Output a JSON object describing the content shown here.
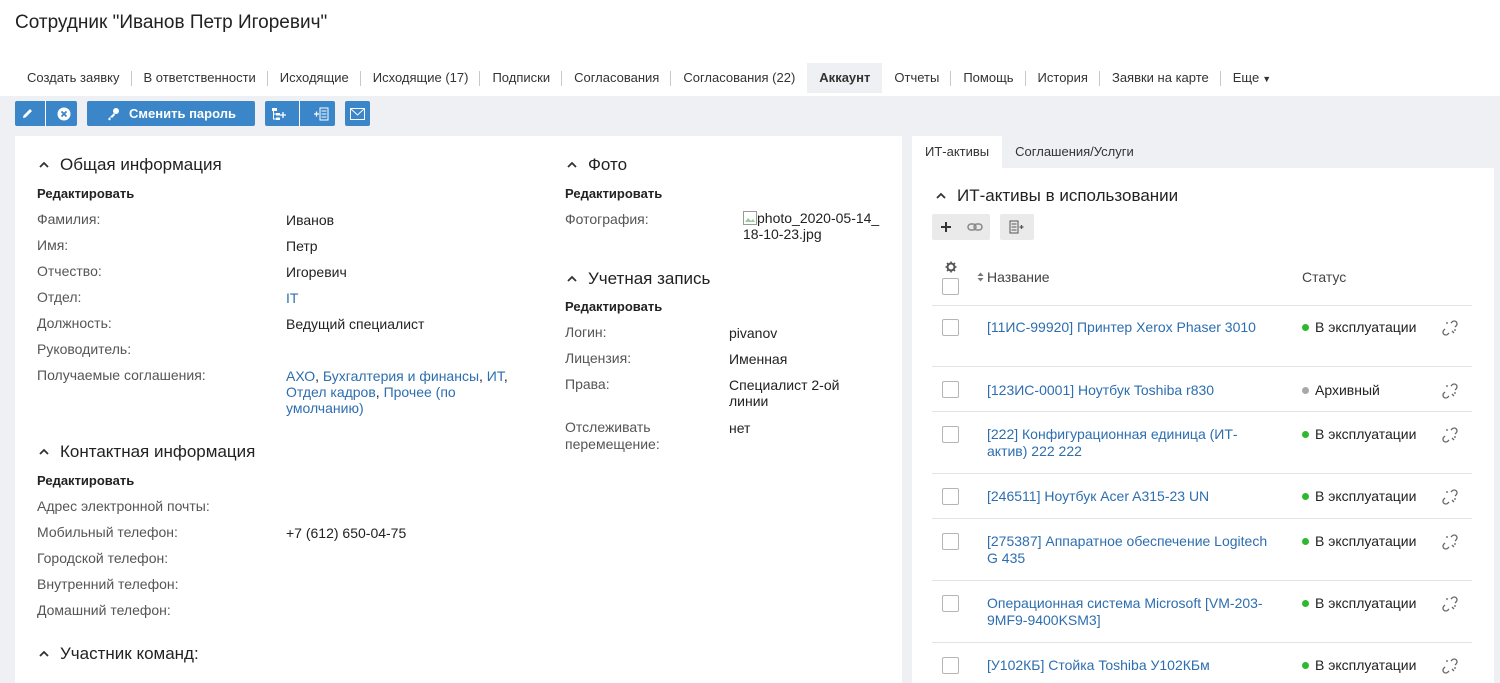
{
  "page": {
    "title": "Сотрудник \"Иванов Петр Игоревич\""
  },
  "tabs": [
    {
      "label": "Создать заявку"
    },
    {
      "label": "В ответственности"
    },
    {
      "label": "Исходящие"
    },
    {
      "label": "Исходящие (17)"
    },
    {
      "label": "Подписки"
    },
    {
      "label": "Согласования"
    },
    {
      "label": "Согласования (22)"
    },
    {
      "label": "Аккаунт"
    },
    {
      "label": "Отчеты"
    },
    {
      "label": "Помощь"
    },
    {
      "label": "История"
    },
    {
      "label": "Заявки на карте"
    },
    {
      "label": "Еще"
    }
  ],
  "active_tab": "Аккаунт",
  "toolbar": {
    "change_password_label": "Сменить пароль"
  },
  "colors": {
    "accent": "#3a86c8",
    "link": "#2d6eb0",
    "status_active": "#2eb82e",
    "status_archive": "#a8a8a8"
  },
  "general": {
    "title": "Общая информация",
    "edit_label": "Редактировать",
    "fields": [
      {
        "label": "Фамилия:",
        "value": "Иванов"
      },
      {
        "label": "Имя:",
        "value": "Петр"
      },
      {
        "label": "Отчество:",
        "value": "Игоревич"
      },
      {
        "label": "Отдел:",
        "value": "IT"
      },
      {
        "label": "Должность:",
        "value": "Ведущий специалист"
      },
      {
        "label": "Руководитель:",
        "value": ""
      },
      {
        "label": "Получаемые соглашения:",
        "value": ""
      }
    ],
    "agreements": [
      "АХО",
      "Бухгалтерия и финансы",
      "ИТ",
      "Отдел кадров",
      "Прочее (по умолчанию)"
    ]
  },
  "contacts": {
    "title": "Контактная информация",
    "edit_label": "Редактировать",
    "fields": [
      {
        "label": "Адрес электронной почты:",
        "value": ""
      },
      {
        "label": "Мобильный телефон:",
        "value": "+7 (612) 650-04-75"
      },
      {
        "label": "Городской телефон:",
        "value": ""
      },
      {
        "label": "Внутренний телефон:",
        "value": ""
      },
      {
        "label": "Домашний телефон:",
        "value": ""
      }
    ]
  },
  "teams": {
    "title": "Участник команд:"
  },
  "photo": {
    "title": "Фото",
    "edit_label": "Редактировать",
    "label": "Фотография:",
    "filename": "photo_2020-05-14_18-10-23.jpg"
  },
  "account": {
    "title": "Учетная запись",
    "edit_label": "Редактировать",
    "fields": [
      {
        "label": "Логин:",
        "value": "pivanov"
      },
      {
        "label": "Лицензия:",
        "value": "Именная"
      },
      {
        "label": "Права:",
        "value": "Специалист 2-ой линии"
      },
      {
        "label": "Отслеживать перемещение:",
        "value": "нет"
      }
    ]
  },
  "right": {
    "tabs": [
      {
        "label": "ИТ-активы"
      },
      {
        "label": "Соглашения/Услуги"
      }
    ],
    "section_title": "ИТ-активы в использовании",
    "columns": {
      "name": "Название",
      "status": "Статус"
    },
    "assets": [
      {
        "name": "[11ИС-99920] Принтер Xerox Phaser 3010",
        "status": "В эксплуатации",
        "state": "active"
      },
      {
        "name": "[123ИС-0001] Ноутбук Toshiba r830",
        "status": "Архивный",
        "state": "archive"
      },
      {
        "name": "[222] Конфигурационная единица (ИТ-актив) 222 222",
        "status": "В эксплуатации",
        "state": "active"
      },
      {
        "name": "[246511] Ноутбук Acer A315-23 UN",
        "status": "В эксплуатации",
        "state": "active"
      },
      {
        "name": "[275387] Аппаратное обеспечение Logitech G 435",
        "status": "В эксплуатации",
        "state": "active"
      },
      {
        "name": "Операционная система Microsoft [VM-203-9MF9-9400KSM3]",
        "status": "В эксплуатации",
        "state": "active"
      },
      {
        "name": "[У102КБ] Стойка Toshiba У102КБм",
        "status": "В эксплуатации",
        "state": "active"
      }
    ]
  }
}
